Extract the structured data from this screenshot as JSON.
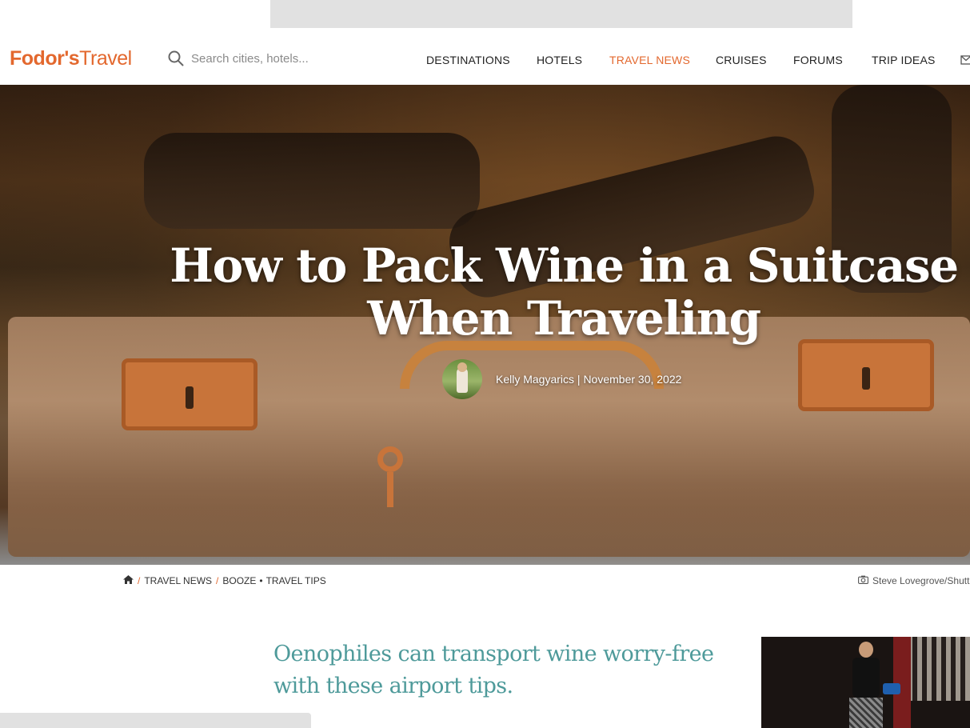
{
  "header": {
    "logo_bold": "Fodor's",
    "logo_light": "Travel",
    "search_placeholder": "Search cities, hotels...",
    "nav": [
      {
        "label": "DESTINATIONS",
        "active": false
      },
      {
        "label": "HOTELS",
        "active": false
      },
      {
        "label": "TRAVEL NEWS",
        "active": true
      },
      {
        "label": "CRUISES",
        "active": false
      },
      {
        "label": "FORUMS",
        "active": false
      },
      {
        "label": "TRIP IDEAS",
        "active": false
      }
    ],
    "accent_color": "#e3682e"
  },
  "hero": {
    "title": "How to Pack Wine in a Suitcase When Traveling",
    "byline": "Kelly Magyarics | November 30, 2022"
  },
  "breadcrumb": {
    "items": [
      "TRAVEL NEWS",
      "BOOZE",
      "TRAVEL TIPS"
    ]
  },
  "photo_credit": "Steve Lovegrove/Shutt",
  "article": {
    "subtitle": "Oenophiles can transport wine worry-free with these airport tips.",
    "subtitle_color": "#4e9a9a"
  }
}
